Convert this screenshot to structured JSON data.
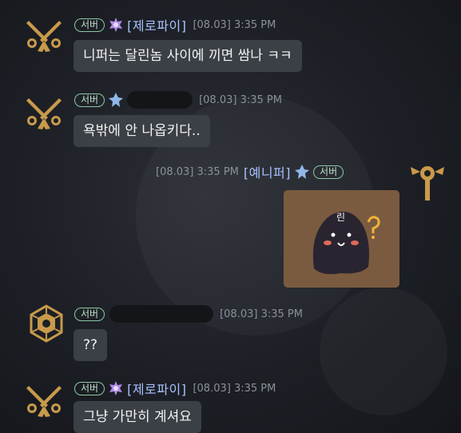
{
  "messages": [
    {
      "server_badge": "서버",
      "name": "[제로파이]",
      "time": "[08.03] 3:35 PM",
      "text": "니퍼는 달린놈 사이에 끼면 쌈나 ㅋㅋ"
    },
    {
      "server_badge": "서버",
      "name": "",
      "time": "[08.03] 3:35 PM",
      "text": "욕밖에 안 나옵키다.."
    },
    {
      "server_badge": "서버",
      "name": "[예니퍼]",
      "time": "[08.03] 3:35 PM",
      "sticker_text": "린"
    },
    {
      "server_badge": "서버",
      "name": "",
      "time": "[08.03] 3:35 PM",
      "text": "??"
    },
    {
      "server_badge": "서버",
      "name": "[제로파이]",
      "time": "[08.03] 3:35 PM",
      "text": "그냥 가만히 계셔요"
    }
  ],
  "colors": {
    "name": "#a9c1ff",
    "badge": "#8fc7a4",
    "bubble": "#3b3f46",
    "emblem_gold": "#c89a4a"
  },
  "icons": {
    "avatar_gunslinger": "crossed-pistols-icon",
    "avatar_mace": "winged-mace-icon",
    "avatar_shield": "hexagon-shield-icon",
    "rank_purple": "purple-rank-icon",
    "rank_blue": "blue-rank-icon"
  }
}
